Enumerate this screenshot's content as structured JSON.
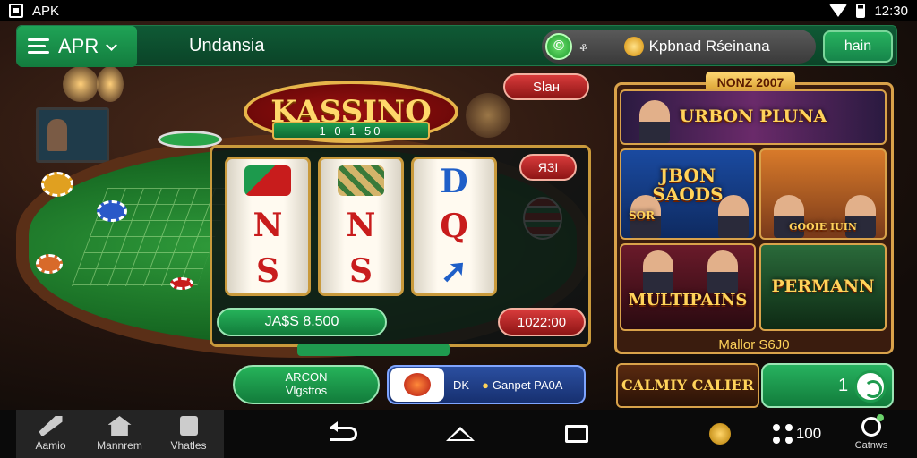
{
  "status_bar": {
    "app_label": "APK",
    "time": "12:30"
  },
  "top_bar": {
    "menu_label": "APR",
    "region": "Undansia",
    "account_small": "ቆ",
    "account_name": "Kpbnad Rśeinana",
    "login_label": "hain"
  },
  "logo": {
    "title": "KASSINO",
    "subtitle": "1 0 1 50"
  },
  "start_button": "Slaн",
  "slot": {
    "reels": [
      [
        "N",
        "S"
      ],
      [
        "N",
        "S"
      ],
      [
        "D",
        "Q"
      ]
    ],
    "side_label": "ЯЗI",
    "balance": "JA$S 8.500",
    "bet": "1022:00"
  },
  "left_pill": {
    "line1": "ARCON",
    "line2": "Vlgsttos"
  },
  "promo": {
    "mid": "DK",
    "text": "Ganpet PA0A"
  },
  "game_panel": {
    "header": "NONZ 2007",
    "tiles": [
      {
        "title": "URBON PLUNA"
      },
      {
        "title": "JBON SAODS",
        "sub": "SOR"
      },
      {
        "title": "",
        "sub": "GOOIE IUIN"
      },
      {
        "title": "MULTIPAINS"
      },
      {
        "title": "PERMANN"
      }
    ],
    "footer": "Mallor S6J0",
    "promo_tile": "CALMIY CALIER",
    "green_value": "1"
  },
  "bottom_nav": {
    "items": [
      {
        "label": "Aamio",
        "icon": "rocket-icon"
      },
      {
        "label": "Mannrem",
        "icon": "house-icon"
      },
      {
        "label": "Vhatles",
        "icon": "box-icon"
      }
    ],
    "tray_value": "100",
    "settings_label": "Catnws"
  },
  "colors": {
    "green": "#16854a",
    "gold": "#d9a24a",
    "red": "#b21a1a",
    "blue": "#1f5fc8"
  }
}
